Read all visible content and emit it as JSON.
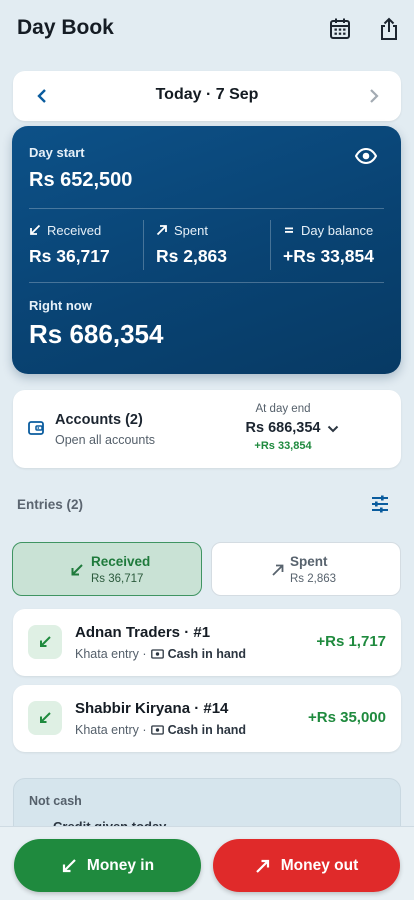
{
  "header": {
    "title": "Day Book",
    "calendar_icon": "calendar-icon",
    "share_icon": "share-icon"
  },
  "date_nav": {
    "label": "Today · 7 Sep",
    "prev_icon": "chevron-left-icon",
    "next_icon": "chevron-right-icon"
  },
  "summary": {
    "day_start_label": "Day start",
    "day_start_value": "Rs 652,500",
    "received_label": "Received",
    "received_value": "Rs 36,717",
    "spent_label": "Spent",
    "spent_value": "Rs 2,863",
    "balance_label": "Day balance",
    "balance_value": "+Rs 33,854",
    "right_now_label": "Right now",
    "right_now_value": "Rs 686,354",
    "eye_icon": "eye-icon"
  },
  "accounts": {
    "title": "Accounts (2)",
    "subtitle": "Open all accounts",
    "day_end_label": "At day end",
    "day_end_value": "Rs 686,354",
    "day_end_change": "+Rs 33,854"
  },
  "entries": {
    "heading": "Entries (2)",
    "tabs": [
      {
        "label": "Received",
        "amount": "Rs 36,717",
        "selected": true
      },
      {
        "label": "Spent",
        "amount": "Rs 2,863",
        "selected": false
      }
    ],
    "items": [
      {
        "name": "Adnan Traders · #1",
        "type": "Khata entry ·",
        "account": "Cash in hand",
        "amount": "+Rs 1,717"
      },
      {
        "name": "Shabbir Kiryana · #14",
        "type": "Khata entry ·",
        "account": "Cash in hand",
        "amount": "+Rs 35,000"
      }
    ]
  },
  "not_cash": {
    "title": "Not cash",
    "item": "Credit given today"
  },
  "actions": {
    "money_in": "Money in",
    "money_out": "Money out"
  },
  "colors": {
    "primary": "#0a4a7e",
    "received": "#1f8a3e",
    "spent": "#e02a2a",
    "background": "#e2ecf2"
  }
}
